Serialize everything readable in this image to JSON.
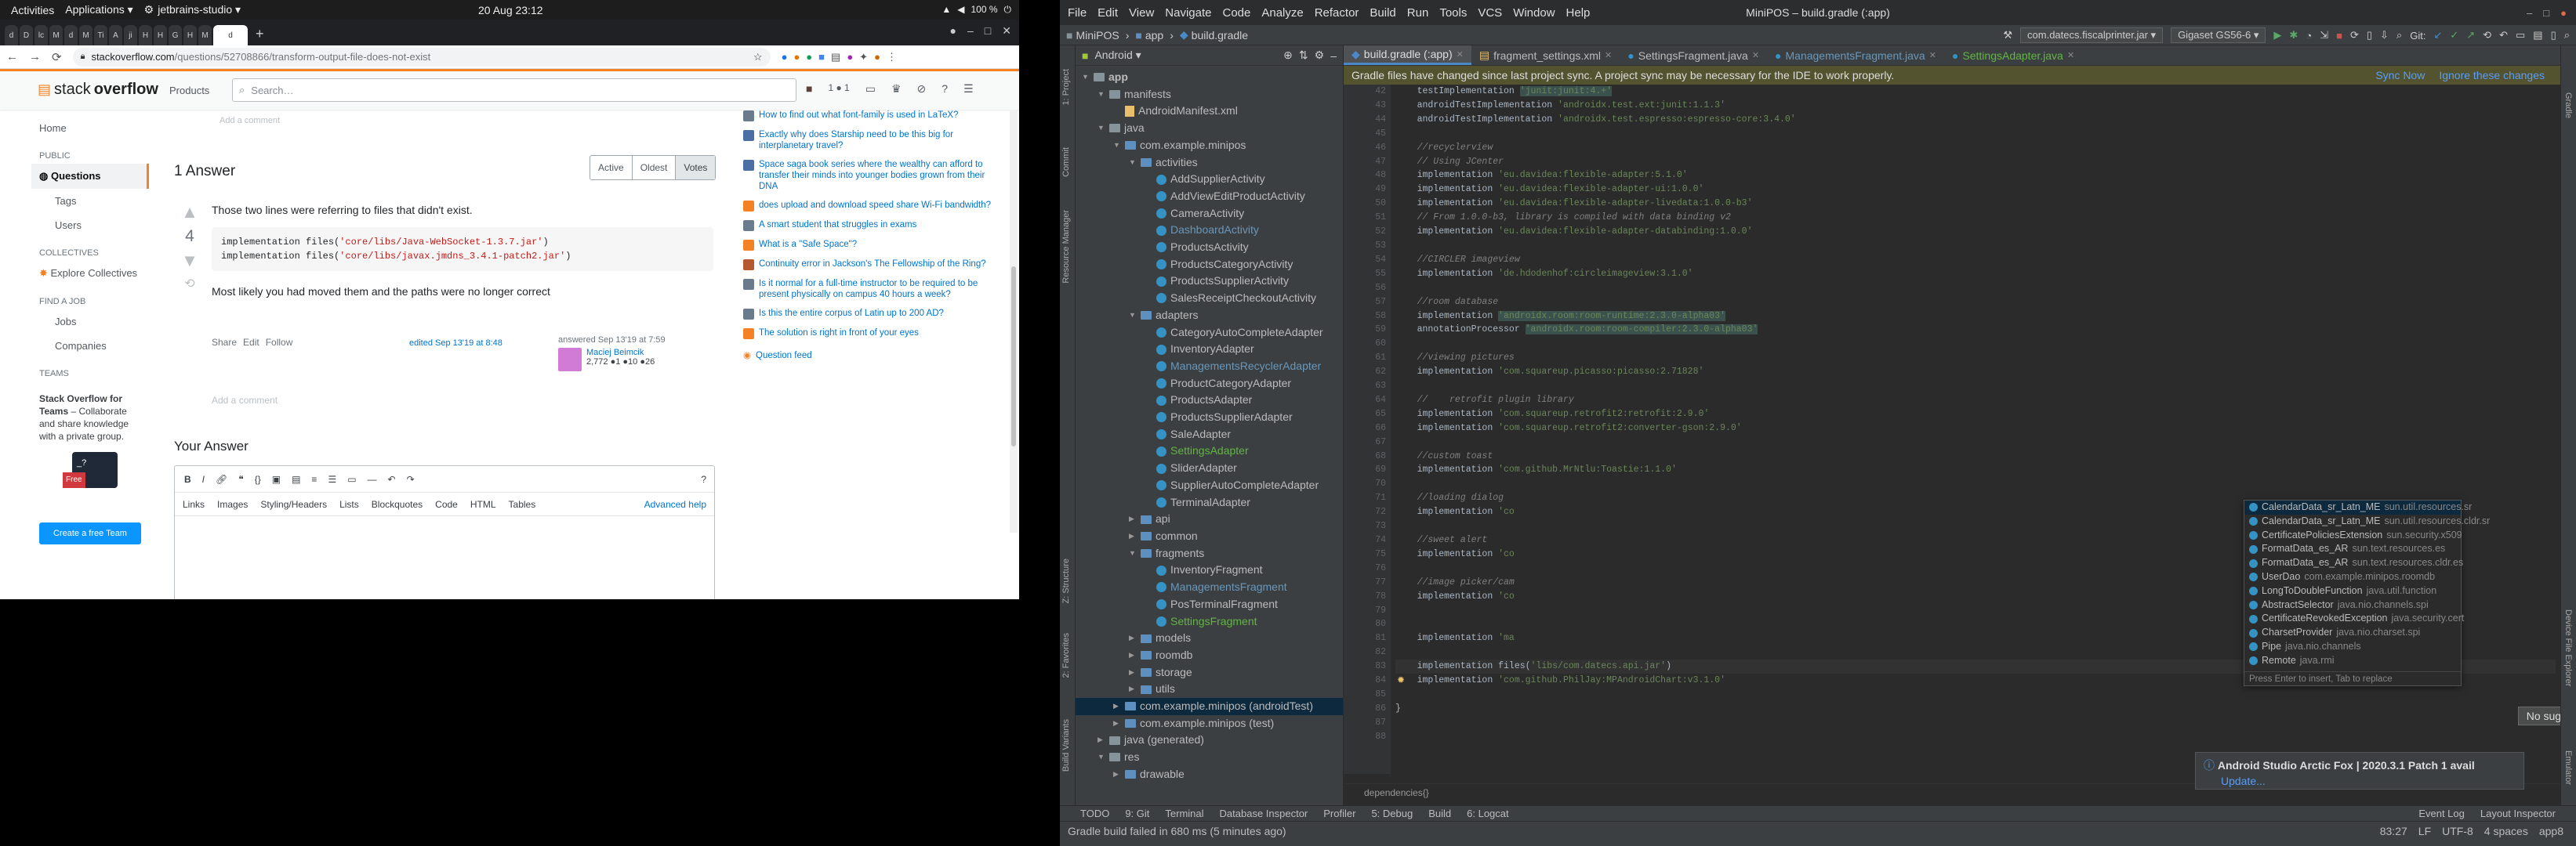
{
  "topbar": {
    "activities": "Activities",
    "applications": "Applications ▾",
    "app": "jetbrains-studio ▾",
    "clock": "20 Aug  23:12",
    "battery": "100 %"
  },
  "chrome": {
    "tabs": [
      "d",
      "D",
      "lc",
      "M",
      "d",
      "M",
      "Ti",
      "A",
      "ji",
      "H",
      "H",
      "G",
      "H",
      "M",
      "d"
    ],
    "url_host": "stackoverflow.com",
    "url_path": "/questions/52708866/transform-output-file-does-not-exist"
  },
  "so": {
    "logo_a": "stack",
    "logo_b": "overflow",
    "products": "Products",
    "search_placeholder": "Search…",
    "rep_badge": "1 ● 1",
    "nav": {
      "home": "Home",
      "public": "PUBLIC",
      "questions": "Questions",
      "tags": "Tags",
      "users": "Users",
      "collectives": "COLLECTIVES",
      "explore": "Explore Collectives",
      "findjob": "FIND A JOB",
      "jobs": "Jobs",
      "companies": "Companies",
      "teams": "TEAMS"
    },
    "teams_text_b": "Stack Overflow for Teams",
    "teams_text": " – Collaborate and share knowledge with a private group.",
    "teams_tag": "Free",
    "teams_cta": "Create a free Team",
    "answers_header": "1 Answer",
    "sort": [
      "Active",
      "Oldest",
      "Votes"
    ],
    "vote_count": "4",
    "answer_line1": "Those two lines were referring to files that didn't exist.",
    "code1_pre": "implementation files(",
    "code1_str": "'core/libs/Java-WebSocket-1.3.7.jar'",
    "code1_post": ")",
    "code2_pre": "implementation files(",
    "code2_str": "'core/libs/javax.jmdns_3.4.1-patch2.jar'",
    "code2_post": ")",
    "answer_line2": "Most likely you had moved them and the paths were no longer correct",
    "post_menu": [
      "Share",
      "Edit",
      "Follow"
    ],
    "edited": "edited Sep 13'19 at 8:48",
    "answered": "answered Sep 13'19 at 7:59",
    "user_name": "Maciej Beimcik",
    "user_rep": "2,772 ●1 ●10 ●26",
    "add_comment": "Add a comment",
    "top_comment": "Add a comment",
    "your_answer": "Your Answer",
    "editor_tabs": [
      "Links",
      "Images",
      "Styling/Headers",
      "Lists",
      "Blockquotes",
      "Code",
      "HTML",
      "Tables"
    ],
    "advanced_help": "Advanced help",
    "hot_questions": [
      "How to find out what font-family is used in LaTeX?",
      "Exactly why does Starship need to be this big for interplanetary travel?",
      "Space saga book series where the wealthy can afford to transfer their minds into younger bodies grown from their DNA",
      "does upload and download speed share Wi-Fi bandwidth?",
      "A smart student that struggles in exams",
      "What is a \"Safe Space\"?",
      "Continuity error in Jackson's The Fellowship of the Ring?",
      "Is it normal for a full-time instructor to be required to be present physically on campus 40 hours a week?",
      "Is this the entire corpus of Latin up to 200 AD?",
      "The solution is right in front of your eyes"
    ],
    "hot_icons": [
      "lt",
      "sc",
      "sc",
      "so",
      "lt",
      "so",
      "mv",
      "lt",
      "lt",
      "so"
    ],
    "question_feed": "Question feed"
  },
  "ide": {
    "menus": [
      "File",
      "Edit",
      "View",
      "Navigate",
      "Code",
      "Analyze",
      "Refactor",
      "Build",
      "Run",
      "Tools",
      "VCS",
      "Window",
      "Help"
    ],
    "window_title": "MiniPOS – build.gradle (:app)",
    "nav_crumbs": [
      "MiniPOS",
      "app",
      "build.gradle"
    ],
    "run_config": "com.datecs.fiscalprinter.jar ▾",
    "device": "Gigaset GS56-6 ▾",
    "git_label": "Git:",
    "project_view": "Android ▾",
    "tabs": [
      "build.gradle (:app)",
      "fragment_settings.xml",
      "SettingsFragment.java",
      "ManagementsFragment.java",
      "SettingsAdapter.java"
    ],
    "banner": "Gradle files have changed since last project sync. A project sync may be necessary for the IDE to work properly.",
    "banner_actions": [
      "Sync Now",
      "Ignore these changes"
    ],
    "left_strip": [
      "1: Project",
      "Commit",
      "Resource Manager",
      "Z: Structure",
      "2: Favorites",
      "Build Variants"
    ],
    "right_strip": [
      "Gradle",
      "Device File Explorer",
      "Emulator"
    ],
    "tree": [
      {
        "t": "app",
        "d": 0,
        "k": "folder",
        "open": true,
        "b": true
      },
      {
        "t": "manifests",
        "d": 1,
        "k": "folder",
        "open": true
      },
      {
        "t": "AndroidManifest.xml",
        "d": 2,
        "k": "xml"
      },
      {
        "t": "java",
        "d": 1,
        "k": "folder",
        "open": true
      },
      {
        "t": "com.example.minipos",
        "d": 2,
        "k": "folder",
        "open": true
      },
      {
        "t": "activities",
        "d": 3,
        "k": "folder",
        "open": true
      },
      {
        "t": "AddSupplierActivity",
        "d": 4,
        "k": "class"
      },
      {
        "t": "AddViewEditProductActivity",
        "d": 4,
        "k": "class"
      },
      {
        "t": "CameraActivity",
        "d": 4,
        "k": "class"
      },
      {
        "t": "DashboardActivity",
        "d": 4,
        "k": "class",
        "c": "mod"
      },
      {
        "t": "ProductsActivity",
        "d": 4,
        "k": "class"
      },
      {
        "t": "ProductsCategoryActivity",
        "d": 4,
        "k": "class"
      },
      {
        "t": "ProductsSupplierActivity",
        "d": 4,
        "k": "class"
      },
      {
        "t": "SalesReceiptCheckoutActivity",
        "d": 4,
        "k": "class"
      },
      {
        "t": "adapters",
        "d": 3,
        "k": "folder",
        "open": true
      },
      {
        "t": "CategoryAutoCompleteAdapter",
        "d": 4,
        "k": "class"
      },
      {
        "t": "InventoryAdapter",
        "d": 4,
        "k": "class"
      },
      {
        "t": "ManagementsRecyclerAdapter",
        "d": 4,
        "k": "class",
        "c": "mod"
      },
      {
        "t": "ProductCategoryAdapter",
        "d": 4,
        "k": "class"
      },
      {
        "t": "ProductsAdapter",
        "d": 4,
        "k": "class"
      },
      {
        "t": "ProductsSupplierAdapter",
        "d": 4,
        "k": "class"
      },
      {
        "t": "SaleAdapter",
        "d": 4,
        "k": "class"
      },
      {
        "t": "SettingsAdapter",
        "d": 4,
        "k": "class",
        "c": "grn"
      },
      {
        "t": "SliderAdapter",
        "d": 4,
        "k": "class"
      },
      {
        "t": "SupplierAutoCompleteAdapter",
        "d": 4,
        "k": "class"
      },
      {
        "t": "TerminalAdapter",
        "d": 4,
        "k": "class"
      },
      {
        "t": "api",
        "d": 3,
        "k": "folder"
      },
      {
        "t": "common",
        "d": 3,
        "k": "folder"
      },
      {
        "t": "fragments",
        "d": 3,
        "k": "folder",
        "open": true
      },
      {
        "t": "InventoryFragment",
        "d": 4,
        "k": "class"
      },
      {
        "t": "ManagementsFragment",
        "d": 4,
        "k": "class",
        "c": "mod"
      },
      {
        "t": "PosTerminalFragment",
        "d": 4,
        "k": "class"
      },
      {
        "t": "SettingsFragment",
        "d": 4,
        "k": "class",
        "c": "grn"
      },
      {
        "t": "models",
        "d": 3,
        "k": "folder"
      },
      {
        "t": "roomdb",
        "d": 3,
        "k": "folder"
      },
      {
        "t": "storage",
        "d": 3,
        "k": "folder"
      },
      {
        "t": "utils",
        "d": 3,
        "k": "folder"
      },
      {
        "t": "com.example.minipos (androidTest)",
        "d": 2,
        "k": "folder",
        "sel": true
      },
      {
        "t": "com.example.minipos (test)",
        "d": 2,
        "k": "folder"
      },
      {
        "t": "java (generated)",
        "d": 1,
        "k": "folder"
      },
      {
        "t": "res",
        "d": 1,
        "k": "folder",
        "open": true
      },
      {
        "t": "drawable",
        "d": 2,
        "k": "folder"
      }
    ],
    "line_numbers": [
      "42",
      "43",
      "44",
      "45",
      "46",
      "47",
      "48",
      "49",
      "50",
      "51",
      "52",
      "53",
      "54",
      "55",
      "56",
      "57",
      "58",
      "59",
      "60",
      "61",
      "62",
      "63",
      "64",
      "65",
      "66",
      "67",
      "68",
      "69",
      "70",
      "71",
      "72",
      "73",
      "74",
      "75",
      "76",
      "77",
      "78",
      "79",
      "80",
      "81",
      "82",
      "83",
      "84",
      "85",
      "86",
      "87",
      "88"
    ],
    "code_lines": [
      {
        "p": "    testImplementation ",
        "s": "'junit:junit:4.+'",
        "h": true
      },
      {
        "p": "    androidTestImplementation ",
        "s": "'androidx.test.ext:junit:1.1.3'"
      },
      {
        "p": "    androidTestImplementation ",
        "s": "'androidx.test.espresso:espresso-core:3.4.0'"
      },
      {
        "p": ""
      },
      {
        "c": "    //recyclerview"
      },
      {
        "c": "    // Using JCenter"
      },
      {
        "p": "    implementation ",
        "s": "'eu.davidea:flexible-adapter:5.1.0'"
      },
      {
        "p": "    implementation ",
        "s": "'eu.davidea:flexible-adapter-ui:1.0.0'"
      },
      {
        "p": "    implementation ",
        "s": "'eu.davidea:flexible-adapter-livedata:1.0.0-b3'"
      },
      {
        "c": "    // From 1.0.0-b3, library is compiled with data binding v2"
      },
      {
        "p": "    implementation ",
        "s": "'eu.davidea:flexible-adapter-databinding:1.0.0'"
      },
      {
        "p": ""
      },
      {
        "c": "    //CIRCLER imageview"
      },
      {
        "p": "    implementation ",
        "s": "'de.hdodenhof:circleimageview:3.1.0'"
      },
      {
        "p": ""
      },
      {
        "c": "    //room database"
      },
      {
        "p": "    implementation ",
        "s": "'androidx.room:room-runtime:2.3.0-alpha03'",
        "h": true
      },
      {
        "p": "    annotationProcessor ",
        "s": "'androidx.room:room-compiler:2.3.0-alpha03'",
        "h": true
      },
      {
        "p": ""
      },
      {
        "c": "    //viewing pictures"
      },
      {
        "p": "    implementation ",
        "s": "'com.squareup.picasso:picasso:2.71828'"
      },
      {
        "p": ""
      },
      {
        "c": "    //    retrofit plugin library"
      },
      {
        "p": "    implementation ",
        "s": "'com.squareup.retrofit2:retrofit:2.9.0'"
      },
      {
        "p": "    implementation ",
        "s": "'com.squareup.retrofit2:converter-gson:2.9.0'"
      },
      {
        "p": ""
      },
      {
        "c": "    //custom toast"
      },
      {
        "p": "    implementation ",
        "s": "'com.github.MrNtlu:Toastie:1.1.0'"
      },
      {
        "p": ""
      },
      {
        "c": "    //loading dialog"
      },
      {
        "p": "    implementation ",
        "s": "'co"
      },
      {
        "p": ""
      },
      {
        "c": "    //sweet alert"
      },
      {
        "p": "    implementation ",
        "s": "'co"
      },
      {
        "p": ""
      },
      {
        "c": "    //image picker/cam"
      },
      {
        "p": "    implementation ",
        "s": "'co"
      },
      {
        "p": ""
      },
      {
        "p": ""
      },
      {
        "p": "    implementation ",
        "s": "'ma"
      },
      {
        "p": ""
      },
      {
        "p": "    implementation files(",
        "s": "'libs/com.datecs.api.jar'",
        "t": ")",
        "cur": true
      },
      {
        "p": "    implementation ",
        "s": "'com.github.PhilJay:MPAndroidChart:v3.1.0'"
      },
      {
        "p": ""
      },
      {
        "p": "}"
      },
      {
        "p": ""
      },
      {
        "p": ""
      }
    ],
    "completions": [
      {
        "n": "CalendarData_sr_Latn_ME",
        "pk": "sun.util.resources.sr"
      },
      {
        "n": "CalendarData_sr_Latn_ME",
        "pk": "sun.util.resources.cldr.sr"
      },
      {
        "n": "CertificatePoliciesExtension",
        "pk": "sun.security.x509"
      },
      {
        "n": "FormatData_es_AR",
        "pk": "sun.text.resources.es"
      },
      {
        "n": "FormatData_es_AR",
        "pk": "sun.text.resources.cldr.es"
      },
      {
        "n": "UserDao",
        "pk": "com.example.minipos.roomdb"
      },
      {
        "n": "LongToDoubleFunction",
        "pk": "java.util.function"
      },
      {
        "n": "AbstractSelector",
        "pk": "java.nio.channels.spi"
      },
      {
        "n": "CertificateRevokedException",
        "pk": "java.security.cert"
      },
      {
        "n": "CharsetProvider",
        "pk": "java.nio.charset.spi"
      },
      {
        "n": "Pipe",
        "pk": "java.nio.channels"
      },
      {
        "n": "Remote",
        "pk": "java.rmi"
      }
    ],
    "completion_hint": "Press Enter to insert, Tab to replace",
    "no_suggestions": "No suggestions",
    "editor_crumb": "dependencies{}",
    "notif_title": "Android Studio Arctic Fox | 2020.3.1 Patch 1 avail",
    "notif_link": "Update...",
    "bottom_tools": [
      "TODO",
      "9: Git",
      "Terminal",
      "Database Inspector",
      "Profiler",
      "5: Debug",
      "Build",
      "6: Logcat"
    ],
    "bottom_tools_right": [
      "Event Log",
      "Layout Inspector"
    ],
    "status_msg": "Gradle build failed in 680 ms (5 minutes ago)",
    "status_right": [
      "83:27",
      "LF",
      "UTF-8",
      "4 spaces",
      "app8"
    ]
  }
}
